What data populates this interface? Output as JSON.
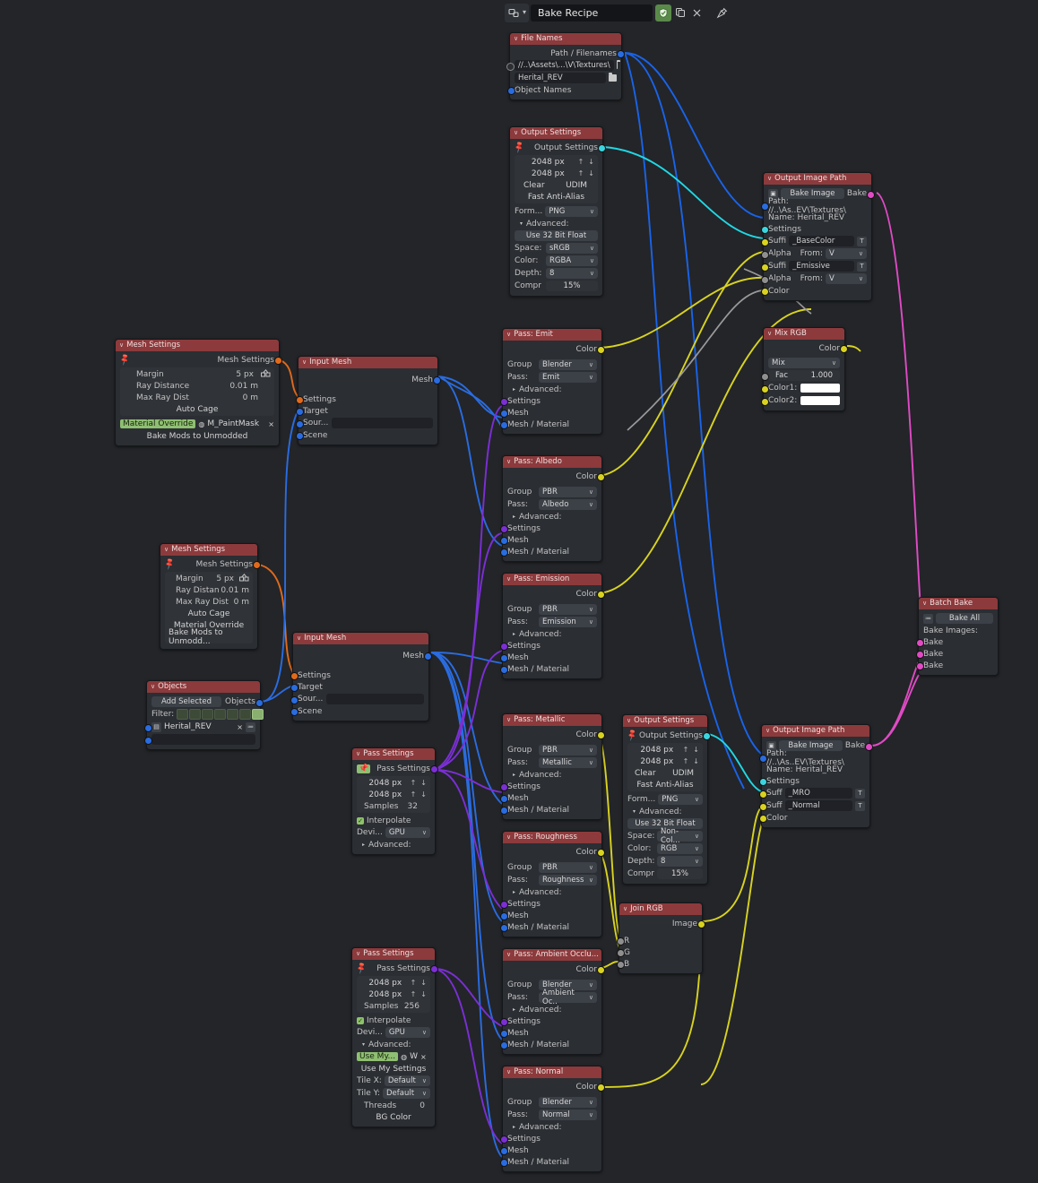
{
  "header": {
    "datablock_icon": "node-tree-icon",
    "dropdown_icon": "chevron-down-icon",
    "name": "Bake Recipe",
    "shield_icon": "shield-icon",
    "copy_icon": "duplicate-icon",
    "close_icon": "close-icon",
    "pin_icon": "pin-icon"
  },
  "nodes": {
    "file_names": {
      "title": "File Names",
      "out_label": "Path / Filenames",
      "path_value": "//..\\Assets\\...\\V\\Textures\\",
      "name_value": "Herital_REV",
      "in_label": "Object Names"
    },
    "output_settings_1": {
      "title": "Output Settings",
      "out_label": "Output Settings",
      "width": "2048 px",
      "height": "2048 px",
      "clear": "Clear",
      "udim": "UDIM",
      "anti_alias": "Fast Anti-Alias",
      "format_label": "Form...",
      "format_value": "PNG",
      "advanced": "Advanced:",
      "float32": "Use 32 Bit Float",
      "space_label": "Space:",
      "space_value": "sRGB",
      "color_label": "Color:",
      "color_value": "RGBA",
      "depth_label": "Depth:",
      "depth_value": "8",
      "compr_label": "Compr",
      "compr_value": "15%"
    },
    "output_settings_2": {
      "title": "Output Settings",
      "out_label": "Output Settings",
      "width": "2048 px",
      "height": "2048 px",
      "clear": "Clear",
      "udim": "UDIM",
      "anti_alias": "Fast Anti-Alias",
      "format_label": "Form...",
      "format_value": "PNG",
      "advanced": "Advanced:",
      "float32": "Use 32 Bit Float",
      "space_label": "Space:",
      "space_value": "Non-Col...",
      "color_label": "Color:",
      "color_value": "RGB",
      "depth_label": "Depth:",
      "depth_value": "8",
      "compr_label": "Compr",
      "compr_value": "15%"
    },
    "mesh_settings_1": {
      "title": "Mesh Settings",
      "out_label": "Mesh Settings",
      "margin_label": "Margin",
      "margin_value": "5 px",
      "ray_label": "Ray Distance",
      "ray_value": "0.01 m",
      "maxray_label": "Max Ray Dist",
      "maxray_value": "0 m",
      "auto_cage": "Auto Cage",
      "material_override": "Material Override",
      "material_value": "M_PaintMask",
      "bake_mods": "Bake Mods to Unmodded"
    },
    "mesh_settings_2": {
      "title": "Mesh Settings",
      "out_label": "Mesh Settings",
      "margin_label": "Margin",
      "margin_value": "5 px",
      "ray_label": "Ray Distan",
      "ray_value": "0.01 m",
      "maxray_label": "Max Ray Dist",
      "maxray_value": "0 m",
      "auto_cage": "Auto Cage",
      "material_override": "Material Override",
      "bake_mods": "Bake Mods to Unmodd..."
    },
    "input_mesh_1": {
      "title": "Input Mesh",
      "out_label": "Mesh",
      "settings": "Settings",
      "target": "Target",
      "source": "Sour...",
      "source_value": "",
      "scene": "Scene"
    },
    "input_mesh_2": {
      "title": "Input Mesh",
      "out_label": "Mesh",
      "settings": "Settings",
      "target": "Target",
      "source": "Sour...",
      "source_value": "",
      "scene": "Scene"
    },
    "objects": {
      "title": "Objects",
      "add_selected": "Add Selected",
      "out_label": "Objects",
      "filter_label": "Filter:",
      "filter_icons": [
        "mesh-filter-icon",
        "curve-filter-icon",
        "surface-filter-icon",
        "meta-filter-icon",
        "text-filter-icon",
        "light-filter-icon",
        "collection-filter-icon"
      ],
      "item_name": "Herital_REV",
      "item_remove_icon": "close-icon",
      "item_pick_icon": "list-icon"
    },
    "pass_settings_1": {
      "title": "Pass Settings",
      "out_label": "Pass Settings",
      "width": "2048 px",
      "height": "2048 px",
      "samples_label": "Samples",
      "samples_value": "32",
      "interpolate": "Interpolate",
      "device_label": "Devi...",
      "device_value": "GPU",
      "advanced": "Advanced:",
      "pinned": true
    },
    "pass_settings_2": {
      "title": "Pass Settings",
      "out_label": "Pass Settings",
      "width": "2048 px",
      "height": "2048 px",
      "samples_label": "Samples",
      "samples_value": "256",
      "interpolate": "Interpolate",
      "device_label": "Devi...",
      "device_value": "GPU",
      "advanced": "Advanced:",
      "use_my_chip": "Use My...",
      "chip_w": "W",
      "chip_close": "×",
      "use_my_settings": "Use My Settings",
      "tilex_label": "Tile X:",
      "tilex_value": "Default",
      "tiley_label": "Tile Y:",
      "tiley_value": "Default",
      "threads_label": "Threads",
      "threads_value": "0",
      "bg_color": "BG Color",
      "pinned": false
    },
    "passes": [
      {
        "id": "emit",
        "title": "Pass: Emit",
        "color_label": "Color",
        "group_label": "Group",
        "group_value": "Blender",
        "pass_label": "Pass:",
        "pass_value": "Emit",
        "advanced": "Advanced:",
        "settings": "Settings",
        "mesh": "Mesh",
        "mesh_material": "Mesh / Material"
      },
      {
        "id": "albedo",
        "title": "Pass: Albedo",
        "color_label": "Color",
        "group_label": "Group",
        "group_value": "PBR",
        "pass_label": "Pass:",
        "pass_value": "Albedo",
        "advanced": "Advanced:",
        "settings": "Settings",
        "mesh": "Mesh",
        "mesh_material": "Mesh / Material"
      },
      {
        "id": "emission",
        "title": "Pass: Emission",
        "color_label": "Color",
        "group_label": "Group",
        "group_value": "PBR",
        "pass_label": "Pass:",
        "pass_value": "Emission",
        "advanced": "Advanced:",
        "settings": "Settings",
        "mesh": "Mesh",
        "mesh_material": "Mesh / Material"
      },
      {
        "id": "metallic",
        "title": "Pass: Metallic",
        "color_label": "Color",
        "group_label": "Group",
        "group_value": "PBR",
        "pass_label": "Pass:",
        "pass_value": "Metallic",
        "advanced": "Advanced:",
        "settings": "Settings",
        "mesh": "Mesh",
        "mesh_material": "Mesh / Material"
      },
      {
        "id": "roughness",
        "title": "Pass: Roughness",
        "color_label": "Color",
        "group_label": "Group",
        "group_value": "PBR",
        "pass_label": "Pass:",
        "pass_value": "Roughness",
        "advanced": "Advanced:",
        "settings": "Settings",
        "mesh": "Mesh",
        "mesh_material": "Mesh / Material"
      },
      {
        "id": "ao",
        "title": "Pass: Ambient Occlu...",
        "color_label": "Color",
        "group_label": "Group",
        "group_value": "Blender",
        "pass_label": "Pass:",
        "pass_value": "Ambient Oc..",
        "advanced": "Advanced:",
        "settings": "Settings",
        "mesh": "Mesh",
        "mesh_material": "Mesh / Material"
      },
      {
        "id": "normal",
        "title": "Pass: Normal",
        "color_label": "Color",
        "group_label": "Group",
        "group_value": "Blender",
        "pass_label": "Pass:",
        "pass_value": "Normal",
        "advanced": "Advanced:",
        "settings": "Settings",
        "mesh": "Mesh",
        "mesh_material": "Mesh / Material"
      }
    ],
    "output_image_path_1": {
      "title": "Output Image Path",
      "bake_image_btn": "Bake Image",
      "bake_out": "Bake",
      "path": "Path: //..\\As..EV\\Textures\\",
      "name": "Name: Herital_REV",
      "settings": "Settings",
      "suffix1_label": "Suffi",
      "suffix1_value": "_BaseColor",
      "alpha1_label": "Alpha",
      "alpha1_from": "From:",
      "alpha1_value": "V",
      "suffix2_label": "Suffi",
      "suffix2_value": "_Emissive",
      "alpha2_label": "Alpha",
      "alpha2_from": "From:",
      "alpha2_value": "V",
      "color": "Color"
    },
    "output_image_path_2": {
      "title": "Output Image Path",
      "bake_image_btn": "Bake Image",
      "bake_out": "Bake",
      "path": "Path: //..\\As..EV\\Textures\\",
      "name": "Name: Herital_REV",
      "settings": "Settings",
      "suffix1_label": "Suff",
      "suffix1_value": "_MRO",
      "suffix2_label": "Suff",
      "suffix2_value": "_Normal",
      "color": "Color"
    },
    "mix_rgb": {
      "title": "Mix RGB",
      "out_label": "Color",
      "blend_mode": "Mix",
      "fac_label": "Fac",
      "fac_value": "1.000",
      "color1_label": "Color1:",
      "color1_value": "#ffffff",
      "color2_label": "Color2:",
      "color2_value": "#ffffff"
    },
    "join_rgb": {
      "title": "Join RGB",
      "out_label": "Image",
      "r": "R",
      "g": "G",
      "b": "B"
    },
    "batch_bake": {
      "title": "Batch Bake",
      "bake_all": "Bake All",
      "bake_images": "Bake Images:",
      "items": [
        "Bake",
        "Bake",
        "Bake"
      ]
    }
  },
  "colors": {
    "background": "#232529",
    "node_header": "#8c3a3c",
    "node_body": "#2b2e33",
    "link_blue": "#1a63e8",
    "link_cyan": "#20d8e4",
    "link_yellow": "#d9d320",
    "link_purple": "#7b2fd4",
    "link_magenta": "#e04bc4",
    "link_grey": "#9a9a9a",
    "link_orange": "#e06a1b"
  }
}
